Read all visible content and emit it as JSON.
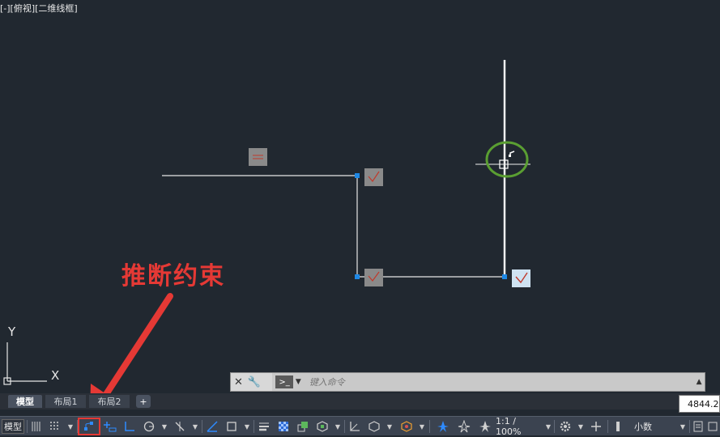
{
  "viewport": {
    "label": "[-][俯视][二维线框]"
  },
  "annotation": {
    "text": "推断约束"
  },
  "ucs": {
    "x_label": "X",
    "y_label": "Y"
  },
  "commandline": {
    "placeholder": "键入命令"
  },
  "tabs": [
    {
      "label": "模型",
      "active": true
    },
    {
      "label": "布局1",
      "active": false
    },
    {
      "label": "布局2",
      "active": false
    }
  ],
  "tab_add": "+",
  "coordinates": "4844.2",
  "statusbar": {
    "model_label": "模型",
    "scale_label": "1:1 / 100%",
    "units_label": "小数",
    "highlighted_tool": "infer-constraints"
  },
  "colors": {
    "background": "#212830",
    "annotation": "#e53935",
    "highlight_circle": "#5a9e32",
    "grip": "#1e88e5"
  }
}
